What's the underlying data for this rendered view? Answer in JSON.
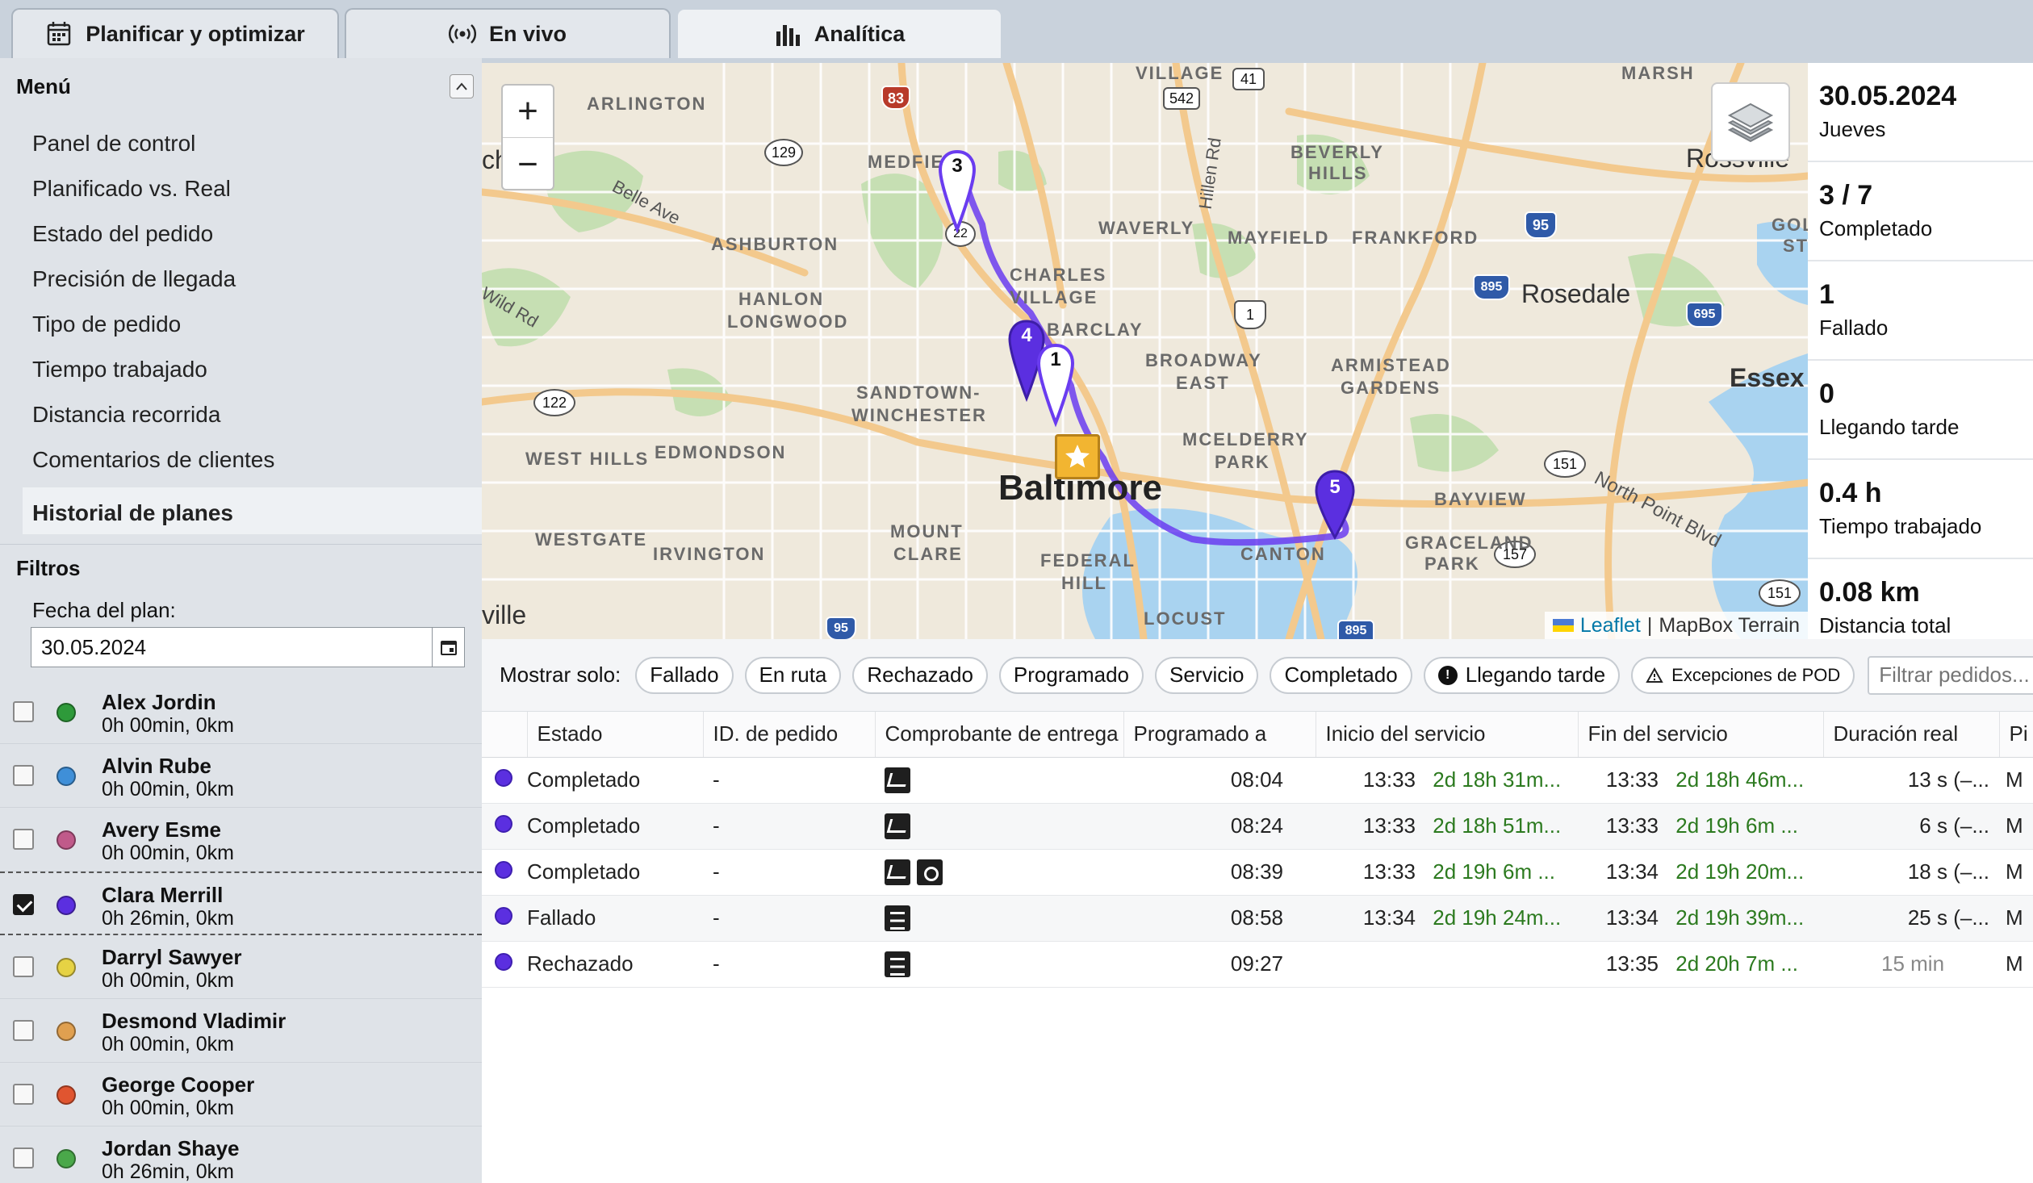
{
  "tabs": [
    {
      "label": "Planificar y optimizar",
      "icon": "calendar-icon"
    },
    {
      "label": "En vivo",
      "icon": "broadcast-icon"
    },
    {
      "label": "Analítica",
      "icon": "bar-chart-icon"
    }
  ],
  "sidebar": {
    "menu_title": "Menú",
    "items": [
      "Panel de control",
      "Planificado vs. Real",
      "Estado del pedido",
      "Precisión de llegada",
      "Tipo de pedido",
      "Tiempo trabajado",
      "Distancia recorrida",
      "Comentarios de clientes"
    ],
    "active_item": "Historial de planes",
    "filters_title": "Filtros",
    "date_label": "Fecha del plan:",
    "date_value": "30.05.2024",
    "drivers": [
      {
        "name": "Alex Jordin",
        "stat": "0h 00min, 0km",
        "color": "#2e9a3a",
        "checked": false
      },
      {
        "name": "Alvin Rube",
        "stat": "0h 00min, 0km",
        "color": "#3f8fd8",
        "checked": false
      },
      {
        "name": "Avery Esme",
        "stat": "0h 00min, 0km",
        "color": "#c05a8a",
        "checked": false
      },
      {
        "name": "Clara Merrill",
        "stat": "0h 26min, 0km",
        "color": "#5b2fe0",
        "checked": true
      },
      {
        "name": "Darryl Sawyer",
        "stat": "0h 00min, 0km",
        "color": "#e6d244",
        "checked": false
      },
      {
        "name": "Desmond Vladimir",
        "stat": "0h 00min, 0km",
        "color": "#e0a050",
        "checked": false
      },
      {
        "name": "George Cooper",
        "stat": "0h 00min, 0km",
        "color": "#e05530",
        "checked": false
      },
      {
        "name": "Jordan Shaye",
        "stat": "0h 26min, 0km",
        "color": "#4aa84a",
        "checked": false
      }
    ]
  },
  "map": {
    "labels": {
      "arlington": "ARLINGTON",
      "medfield": "MEDFIELD",
      "ashburton": "ASHBURTON",
      "hanlon": "HANLON",
      "longwood": "LONGWOOD",
      "waverly": "WAVERLY",
      "charles": "CHARLES",
      "village": "VILLAGE",
      "barclay": "BARCLAY",
      "mayfield": "MAYFIELD",
      "beverly": "BEVERLY",
      "hills": "HILLS",
      "frankford": "FRANKFORD",
      "broadway": "BROADWAY",
      "east": "EAST",
      "armistead": "ARMISTEAD",
      "gardens": "GARDENS",
      "sandtown": "SANDTOWN-",
      "winchester": "WINCHESTER",
      "westhills": "WEST HILLS",
      "edmondson": "EDMONDSON",
      "mcelderry": "MCELDERRY",
      "park": "PARK",
      "westgate": "WESTGATE",
      "irvington": "IRVINGTON",
      "mount": "MOUNT",
      "clare": "CLARE",
      "federal": "FEDERAL",
      "hill": "HILL",
      "canton": "CANTON",
      "bayview": "BAYVIEW",
      "graceland": "GRACELAND",
      "gpark": "PARK",
      "locust": "LOCUST",
      "golden": "GOLDEN",
      "stat": "STAT",
      "village_top": "VILLAGE",
      "marsh": "MARSH"
    },
    "city": "Baltimore",
    "towns": {
      "rosedale": "Rosedale",
      "essex": "Essex",
      "ville": "ville",
      "ch": "ch",
      "rossville": "Rossville"
    },
    "streets": {
      "belle": "Belle Ave",
      "wild": "Wild Rd",
      "hillen": "Hillen Rd",
      "northpoint": "North Point Blvd"
    },
    "shields": {
      "s83": "83",
      "s542": "542",
      "s41": "41",
      "s129": "129",
      "s1": "1",
      "s95a": "95",
      "s895a": "895",
      "s695": "695",
      "s122": "122",
      "s151a": "151",
      "s157": "157",
      "s151b": "151",
      "s95b": "95",
      "s895b": "895",
      "s22": "22"
    },
    "markers": {
      "m3": "3",
      "m4": "4",
      "m1": "1",
      "m5": "5"
    },
    "zoom_in": "+",
    "zoom_out": "−",
    "attribution_leaflet": "Leaflet",
    "attribution_sep": "|",
    "attribution_tiles": "MapBox Terrain"
  },
  "stats": [
    {
      "value": "30.05.2024",
      "label": "Jueves"
    },
    {
      "value": "3 / 7",
      "label": "Completado"
    },
    {
      "value": "1",
      "label": "Fallado"
    },
    {
      "value": "0",
      "label": "Llegando tarde"
    },
    {
      "value": "0.4 h",
      "label": "Tiempo trabajado"
    },
    {
      "value": "0.08 km",
      "label": "Distancia total"
    }
  ],
  "orders": {
    "filter_label": "Mostrar solo:",
    "chips": [
      "Fallado",
      "En ruta",
      "Rechazado",
      "Programado",
      "Servicio",
      "Completado",
      "Llegando tarde",
      "Excepciones de POD"
    ],
    "search_placeholder": "Filtrar pedidos...",
    "columns": [
      "Estado",
      "ID. de pedido",
      "Comprobante de entrega",
      "Programado a",
      "Inicio del servicio",
      "Fin del servicio",
      "Duración real",
      "Pi"
    ],
    "rows": [
      {
        "status": "Completado",
        "id": "-",
        "pod": [
          "signature"
        ],
        "scheduled": "08:04",
        "start_time": "13:33",
        "start_rel": "2d 18h 31m...",
        "end_time": "13:33",
        "end_rel": "2d 18h 46m...",
        "duration": "13 s (–...",
        "pi": "M"
      },
      {
        "status": "Completado",
        "id": "-",
        "pod": [
          "signature"
        ],
        "scheduled": "08:24",
        "start_time": "13:33",
        "start_rel": "2d 18h 51m...",
        "end_time": "13:33",
        "end_rel": "2d 19h 6m ...",
        "duration": "6 s (–...",
        "pi": "M"
      },
      {
        "status": "Completado",
        "id": "-",
        "pod": [
          "signature",
          "photo"
        ],
        "scheduled": "08:39",
        "start_time": "13:33",
        "start_rel": "2d 19h 6m ...",
        "end_time": "13:34",
        "end_rel": "2d 19h 20m...",
        "duration": "18 s (–...",
        "pi": "M"
      },
      {
        "status": "Fallado",
        "id": "-",
        "pod": [
          "note"
        ],
        "scheduled": "08:58",
        "start_time": "13:34",
        "start_rel": "2d 19h 24m...",
        "end_time": "13:34",
        "end_rel": "2d 19h 39m...",
        "duration": "25 s (–...",
        "pi": "M"
      },
      {
        "status": "Rechazado",
        "id": "-",
        "pod": [
          "note"
        ],
        "scheduled": "09:27",
        "start_time": "",
        "start_rel": "",
        "end_time": "13:35",
        "end_rel": "2d 20h 7m ...",
        "duration": "15 min",
        "pi": "M"
      }
    ]
  },
  "colors": {
    "route": "#6a3cf0",
    "marker": "#5b2fe0",
    "water": "#a9d3f0",
    "park": "#c6dfb3",
    "road": "#f3c98d"
  }
}
